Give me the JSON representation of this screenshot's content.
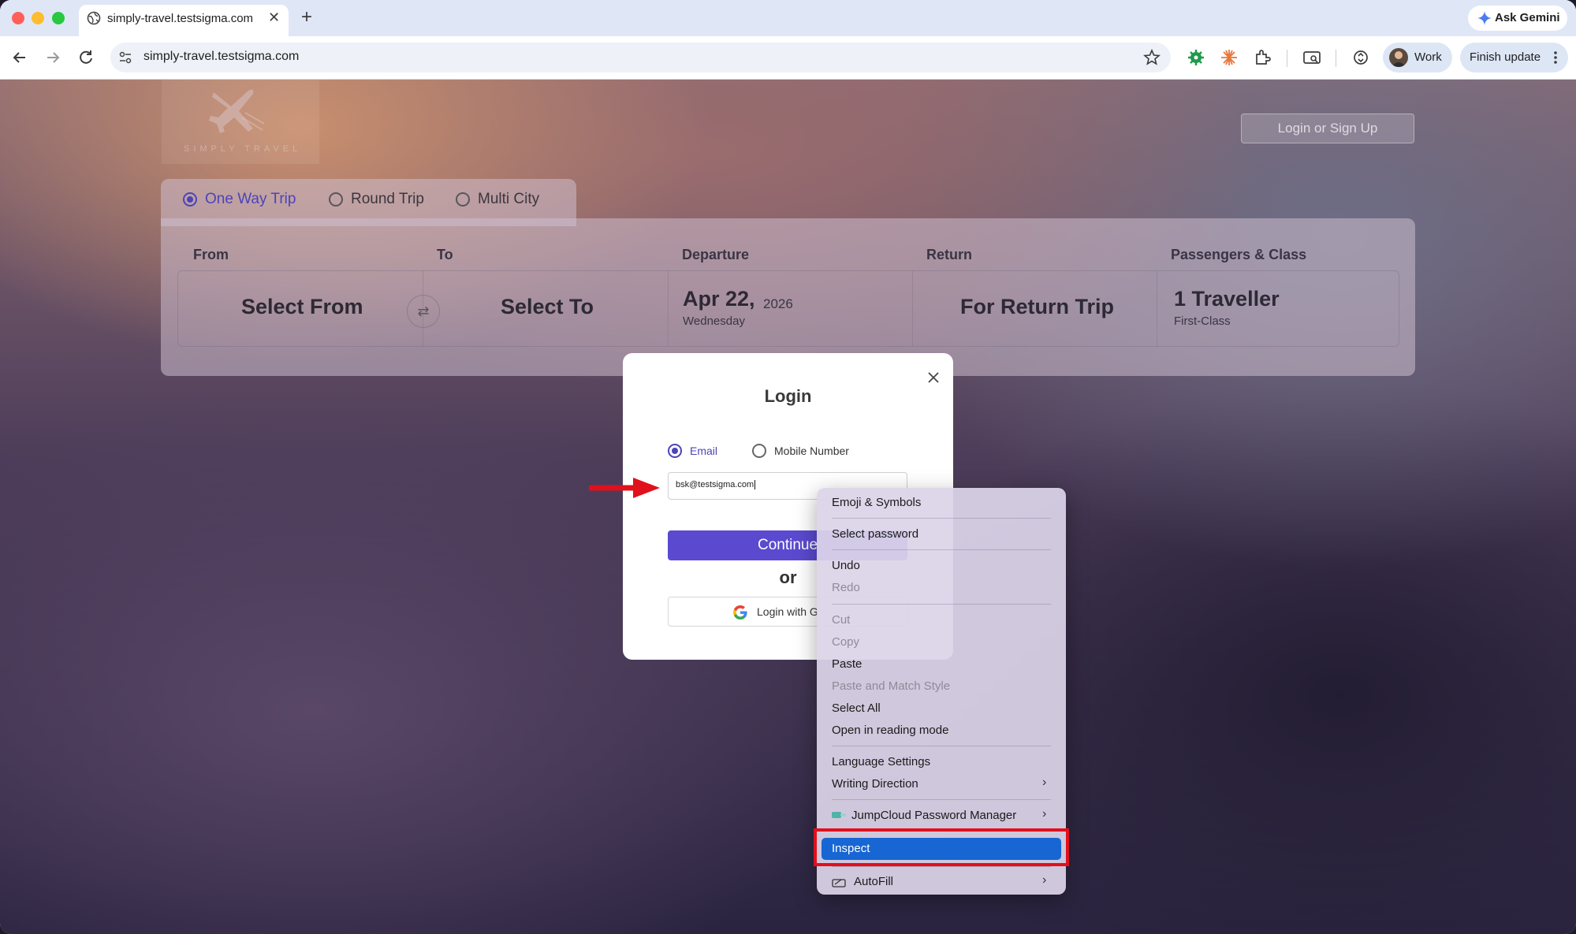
{
  "browser": {
    "tab_title": "simply-travel.testsigma.com",
    "tab_close": "✕",
    "new_tab": "+",
    "ask_gemini": "Ask Gemini",
    "url": "simply-travel.testsigma.com",
    "profile_label": "Work",
    "finish_update": "Finish update"
  },
  "site": {
    "logo_text": "SIMPLY TRAVEL",
    "login_signup": "Login or Sign Up",
    "trip_types": [
      "One Way Trip",
      "Round Trip",
      "Multi City"
    ],
    "selected_trip_type": "One Way Trip",
    "labels": {
      "from": "From",
      "to": "To",
      "departure": "Departure",
      "return": "Return",
      "passengers": "Passengers & Class"
    },
    "from_value": "Select From",
    "swap_icon": "⇄",
    "to_value": "Select To",
    "departure_date": "Apr 22,",
    "departure_year": "2026",
    "departure_day": "Wednesday",
    "return_value": "For Return Trip",
    "travellers": "1 Traveller",
    "class": "First-Class"
  },
  "login_modal": {
    "title": "Login",
    "option_email": "Email",
    "option_mobile": "Mobile Number",
    "selected_option": "Email",
    "email_value": "bsk@testsigma.com",
    "continue_label": "Continue",
    "or_label": "or",
    "google_label": "Login with G"
  },
  "context_menu": {
    "items": [
      {
        "label": "Emoji & Symbols",
        "enabled": true
      },
      {
        "label": "Select password",
        "enabled": true
      },
      {
        "label": "Undo",
        "enabled": true
      },
      {
        "label": "Redo",
        "enabled": false
      },
      {
        "label": "Cut",
        "enabled": false
      },
      {
        "label": "Copy",
        "enabled": false
      },
      {
        "label": "Paste",
        "enabled": true
      },
      {
        "label": "Paste and Match Style",
        "enabled": false
      },
      {
        "label": "Select All",
        "enabled": true
      },
      {
        "label": "Open in reading mode",
        "enabled": true
      },
      {
        "label": "Language Settings",
        "enabled": true
      },
      {
        "label": "Writing Direction",
        "enabled": true,
        "submenu": true
      },
      {
        "label": "JumpCloud Password Manager",
        "enabled": true,
        "submenu": true
      },
      {
        "label": "Inspect",
        "enabled": true,
        "highlighted": true
      },
      {
        "label": "AutoFill",
        "enabled": true,
        "submenu": true
      }
    ],
    "chevron": "›"
  },
  "colors": {
    "accent": "#5b4ad0",
    "menu_highlight": "#1766d3",
    "annotation_red": "#e0101c"
  }
}
